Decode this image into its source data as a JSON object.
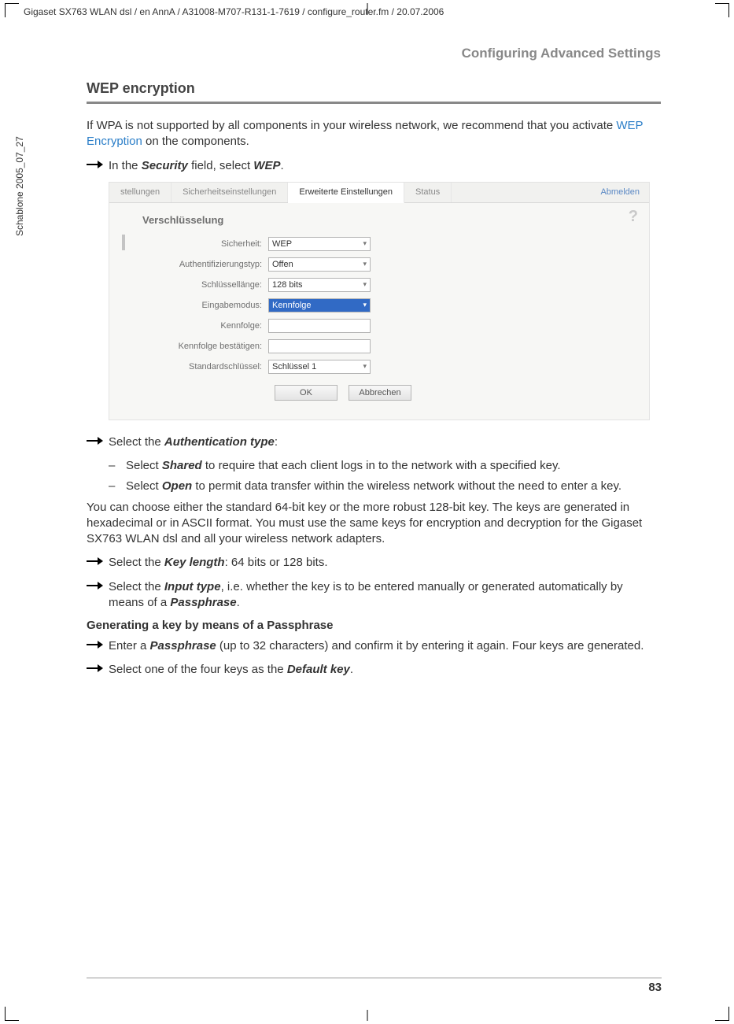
{
  "doc_header": "Gigaset SX763 WLAN dsl / en AnnA / A31008-M707-R131-1-7619 / configure_router.fm / 20.07.2006",
  "vertical_text": "Schablone 2005_07_27",
  "running_head": "Configuring Advanced Settings",
  "section_title": "WEP encryption",
  "intro_pre": "If WPA is not supported by all components in your wireless network, we recommend that you activate ",
  "intro_link": "WEP Encryption",
  "intro_post": " on the components.",
  "step1_pre": "In the ",
  "step1_field": "Security",
  "step1_mid": " field, select ",
  "step1_val": "WEP",
  "step1_end": ".",
  "screenshot": {
    "tabs": {
      "einstellungen": "stellungen",
      "sicherheit": "Sicherheitseinstellungen",
      "erweitert": "Erweiterte Einstellungen",
      "status": "Status"
    },
    "logoff": "Abmelden",
    "panel_title": "Verschlüsselung",
    "labels": {
      "security": "Sicherheit:",
      "authtype": "Authentifizierungstyp:",
      "keylen": "Schlüssellänge:",
      "inputmode": "Eingabemodus:",
      "passphrase": "Kennfolge:",
      "confirm": "Kennfolge bestätigen:",
      "defaultkey": "Standardschlüssel:"
    },
    "values": {
      "security": "WEP",
      "authtype": "Offen",
      "keylen": "128 bits",
      "inputmode": "Kennfolge",
      "defaultkey": "Schlüssel 1"
    },
    "buttons": {
      "ok": "OK",
      "cancel": "Abbrechen"
    }
  },
  "step2_pre": "Select the ",
  "step2_field": "Authentication type",
  "step2_end": ":",
  "sub1_pre": "Select ",
  "sub1_val": "Shared",
  "sub1_post": " to require that each client logs in to the network with a specified key.",
  "sub2_pre": "Select ",
  "sub2_val": "Open",
  "sub2_post": " to permit data transfer within the wireless network without the need to enter a key.",
  "keys_para": "You can choose either the standard 64-bit key or the more robust 128-bit key. The keys are generated in hexadecimal or in ASCII format. You must use the same keys for encryption and decryption for the Gigaset SX763 WLAN dsl and all your wireless network adapters.",
  "step3_pre": "Select the ",
  "step3_field": "Key length",
  "step3_post": ": 64 bits or 128 bits.",
  "step4_pre": "Select the ",
  "step4_field": "Input type",
  "step4_mid": ", i.e. whether the key is to be entered manually or generated automatically by means of a ",
  "step4_field2": "Passphrase",
  "step4_end": ".",
  "h4": "Generating a key by means of a Passphrase",
  "step5_pre": "Enter a ",
  "step5_field": "Passphrase",
  "step5_post": " (up to 32 characters) and confirm it by entering it again. Four keys are generated.",
  "step6_pre": "Select one of the four keys as the ",
  "step6_field": "Default key",
  "step6_end": ".",
  "page_number": "83"
}
